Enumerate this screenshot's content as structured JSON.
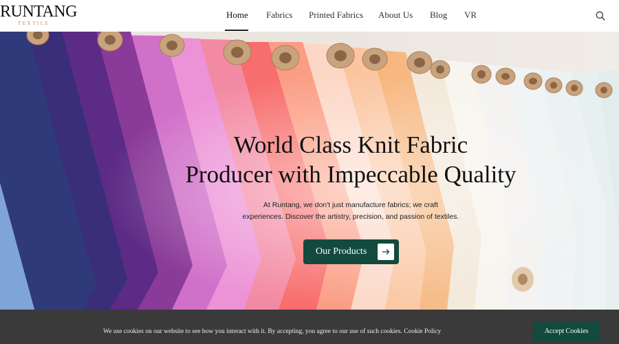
{
  "header": {
    "logo_text": "RUNTANG",
    "logo_subtext": "TEXTILE",
    "nav": [
      {
        "label": "Home",
        "active": true
      },
      {
        "label": "Fabrics",
        "active": false
      },
      {
        "label": "Printed Fabrics",
        "active": false
      },
      {
        "label": "About Us",
        "active": false
      },
      {
        "label": "Blog",
        "active": false
      },
      {
        "label": "VR",
        "active": false
      }
    ],
    "search_icon": "search-icon"
  },
  "hero": {
    "title_line1": "World Class Knit Fabric",
    "title_line2": "Producer with Impeccable Quality",
    "subtitle_line1": "At Runtang, we don't just manufacture fabrics; we craft",
    "subtitle_line2": "experiences. Discover the artistry, precision, and passion of textiles.",
    "cta_label": "Our Products",
    "cta_icon": "arrow-right-icon",
    "image": "colorful fabric rolls"
  },
  "cookie_bar": {
    "text": "We use cookies on our website to see how you interact with it. By accepting, you agree to our use of such cookies.",
    "link_label": "Cookie Policy",
    "accept_label": "Accept Cookies"
  },
  "colors": {
    "brand_green": "#124a3d",
    "cookie_bg": "#3a3a3a",
    "logo_accent": "#b9855a"
  }
}
